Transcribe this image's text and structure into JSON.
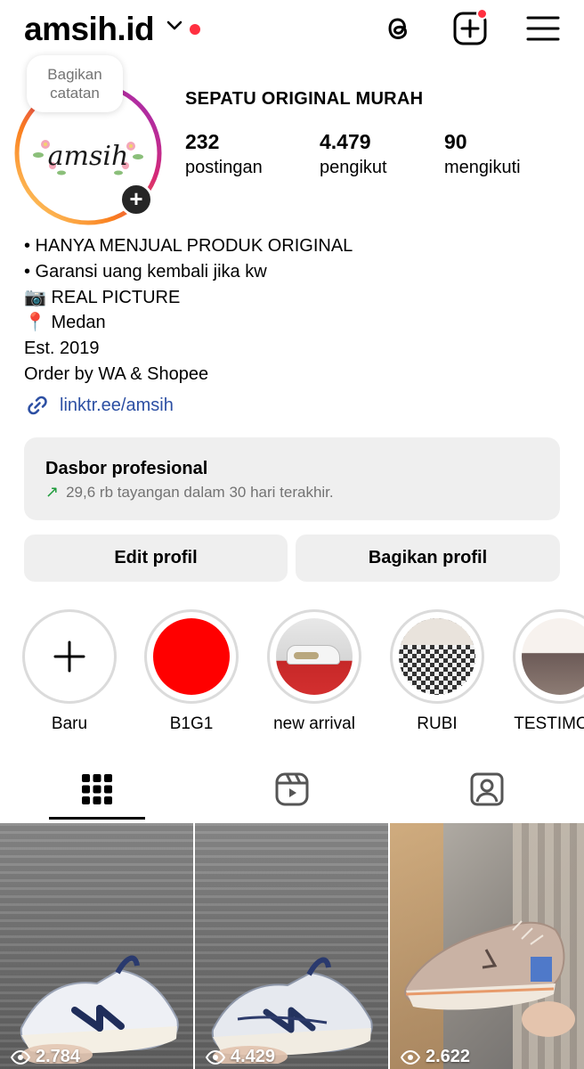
{
  "header": {
    "username": "amsih.id",
    "icons": [
      "chevron-down-icon",
      "threads-icon",
      "create-icon",
      "menu-icon"
    ],
    "accent_color": "#ff3040"
  },
  "profile": {
    "note_placeholder": "Bagikan catatan",
    "avatar_logo_text": "amsih",
    "full_name": "SEPATU ORIGINAL MURAH",
    "stats": [
      {
        "value": "232",
        "label": "postingan"
      },
      {
        "value": "4.479",
        "label": "pengikut"
      },
      {
        "value": "90",
        "label": "mengikuti"
      }
    ],
    "bio": [
      "• HANYA MENJUAL PRODUK ORIGINAL",
      "• Garansi uang kembali jika kw",
      "📷 REAL PICTURE",
      "📍 Medan",
      "Est. 2019",
      "Order by WA & Shopee"
    ],
    "link": "linktr.ee/amsih"
  },
  "dashboard": {
    "title": "Dasbor profesional",
    "subtitle": "29,6 rb tayangan dalam 30 hari terakhir."
  },
  "buttons": {
    "edit": "Edit profil",
    "share": "Bagikan profil"
  },
  "highlights": [
    {
      "label": "Baru"
    },
    {
      "label": "B1G1"
    },
    {
      "label": "new arrival"
    },
    {
      "label": "RUBI"
    },
    {
      "label": "TESTIMONI"
    }
  ],
  "tabs": [
    "grid-icon",
    "reels-icon",
    "tagged-icon"
  ],
  "posts": [
    {
      "views": "2.784"
    },
    {
      "views": "4.429"
    },
    {
      "views": "2.622"
    }
  ]
}
